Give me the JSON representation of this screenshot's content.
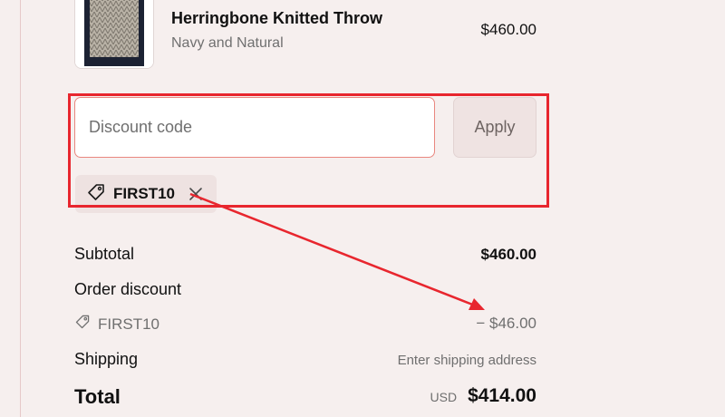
{
  "product": {
    "title": "Herringbone Knitted Throw",
    "variant": "Navy and Natural",
    "price": "$460.00",
    "image_icon": "product-thumbnail"
  },
  "discount": {
    "placeholder": "Discount code",
    "value": "",
    "apply_label": "Apply",
    "applied_code": "FIRST10",
    "tag_icon": "tag-icon",
    "remove_icon": "close-icon"
  },
  "summary": {
    "subtotal_label": "Subtotal",
    "subtotal_value": "$460.00",
    "order_discount_label": "Order discount",
    "discount_code": "FIRST10",
    "discount_amount": "− $46.00",
    "shipping_label": "Shipping",
    "shipping_value": "Enter shipping address",
    "total_label": "Total",
    "currency": "USD",
    "total_value": "$414.00"
  },
  "colors": {
    "annotation": "#e8262e",
    "background": "#f6efee",
    "input_border": "#e9877f"
  }
}
